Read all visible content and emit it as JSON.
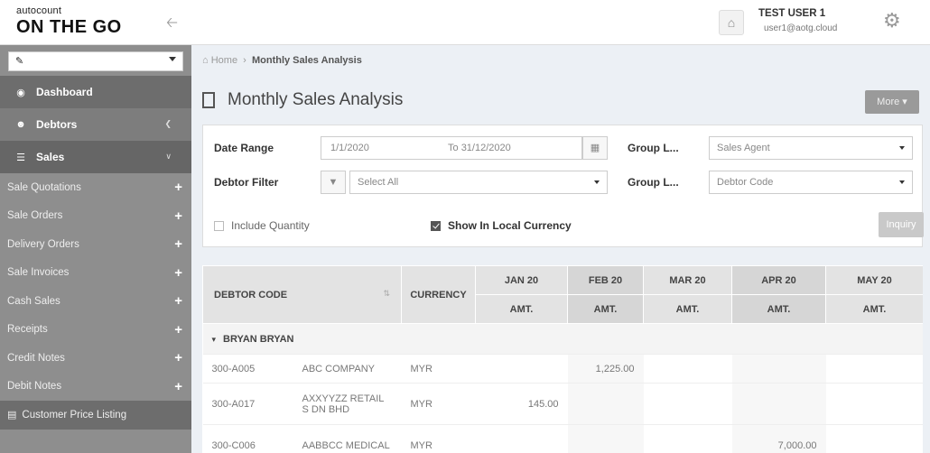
{
  "brand": {
    "small": "autocount",
    "big": "ON THE GO"
  },
  "company_selector": {
    "value": ""
  },
  "sidebar": {
    "main": [
      {
        "label": "Dashboard"
      },
      {
        "label": "Debtors"
      },
      {
        "label": "Sales"
      }
    ],
    "sub": [
      {
        "label": "Sale Quotations"
      },
      {
        "label": "Sale Orders"
      },
      {
        "label": "Delivery Orders"
      },
      {
        "label": "Sale Invoices"
      },
      {
        "label": "Cash Sales"
      },
      {
        "label": "Receipts"
      },
      {
        "label": "Credit Notes"
      },
      {
        "label": "Debit Notes"
      }
    ],
    "listing": "Customer Price Listing"
  },
  "user": {
    "name": "TEST USER 1",
    "email": "user1@aotg.cloud"
  },
  "breadcrumb": {
    "home": "Home",
    "current": "Monthly Sales Analysis"
  },
  "page": {
    "title": "Monthly Sales Analysis",
    "more_label": "More"
  },
  "filters": {
    "date_range_label": "Date Range",
    "date_from": "1/1/2020",
    "date_to_prefix": "To",
    "date_to": "31/12/2020",
    "group1_label": "Group L...",
    "group1_value": "Sales Agent",
    "debtor_filter_label": "Debtor Filter",
    "debtor_filter_placeholder": "Select All",
    "group2_label": "Group L...",
    "group2_value": "Debtor Code",
    "include_quantity_label": "Include Quantity",
    "include_quantity_checked": false,
    "local_currency_label": "Show In Local Currency",
    "local_currency_checked": true,
    "inquiry_label": "Inquiry"
  },
  "table": {
    "col_debtor": "DEBTOR CODE",
    "col_currency": "CURRENCY",
    "months": [
      "JAN 20",
      "FEB 20",
      "MAR 20",
      "APR 20",
      "MAY 20"
    ],
    "sub_label": "AMT.",
    "group_name": "BRYAN BRYAN",
    "rows": [
      {
        "code": "300-A005",
        "name": "ABC COMPANY",
        "currency": "MYR",
        "amounts": [
          "",
          "1,225.00",
          "",
          "",
          ""
        ]
      },
      {
        "code": "300-A017",
        "name": "AXXYYZZ RETAIL S DN BHD",
        "currency": "MYR",
        "amounts": [
          "145.00",
          "",
          "",
          "",
          ""
        ]
      },
      {
        "code": "300-C006",
        "name": "AABBCC MEDICAL",
        "currency": "MYR",
        "amounts": [
          "",
          "",
          "",
          "7,000.00",
          ""
        ]
      }
    ]
  }
}
